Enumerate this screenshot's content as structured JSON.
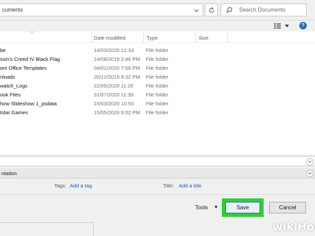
{
  "address_bar": {
    "path": "cuments",
    "search_placeholder": "Search Documents"
  },
  "toolbar": {
    "help": "?"
  },
  "columns": {
    "name_sort": "^",
    "date": "Date modified",
    "type": "Type",
    "size": "Size"
  },
  "files": [
    {
      "name": "be",
      "date": "14/03/2020 12:33",
      "type": "File folder"
    },
    {
      "name": "ssin's Creed IV Black Flag",
      "date": "14/08/2019 2:46 PM",
      "type": "File folder"
    },
    {
      "name": "om Office Templates",
      "date": "04/01/2020 7:56 PM",
      "type": "File folder"
    },
    {
      "name": "nloads",
      "date": "20/12/2019 8:32 PM",
      "type": "File folder"
    },
    {
      "name": "watch_Logs",
      "date": "22/05/2020 11:20",
      "type": "File folder"
    },
    {
      "name": "ook Files",
      "date": "31/07/2020 11:39",
      "type": "File folder"
    },
    {
      "name": "how Slideshow 1_psdata",
      "date": "15/03/2020 10:50",
      "type": "File folder"
    },
    {
      "name": "tstar Games",
      "date": "15/05/2020 8:02 PM",
      "type": "File folder"
    }
  ],
  "save_as_type": {
    "value": "ntation"
  },
  "meta": {
    "tags_label": "Tags:",
    "tags_link": "Add a tag",
    "title_label": "Title:",
    "title_link": "Add a title"
  },
  "footer": {
    "tools": "Tools",
    "save": "Save",
    "cancel": "Cancel"
  },
  "watermark": "wikiHow",
  "colors": {
    "highlight": "#2fd12f",
    "link": "#1a5fb4",
    "help": "#1f6fc5"
  }
}
